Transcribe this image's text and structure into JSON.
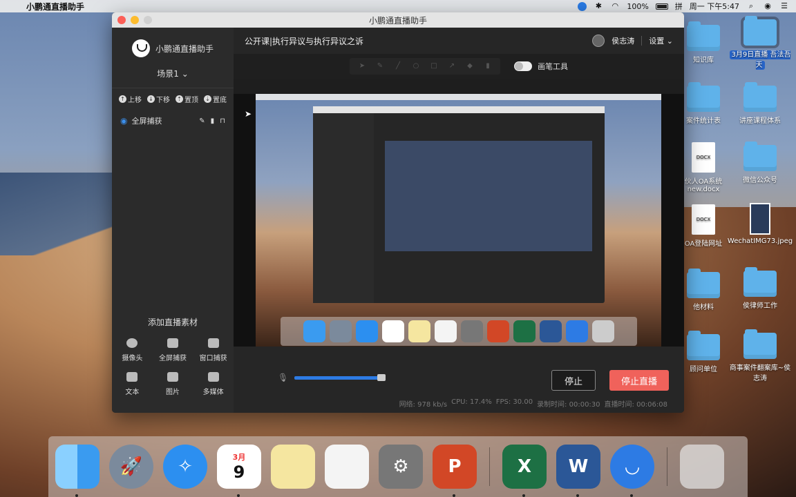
{
  "menubar": {
    "app_name": "小鹏通直播助手",
    "battery": "100%",
    "input_method": "拼",
    "datetime": "周一 下午5:47"
  },
  "desktop": {
    "icons": [
      {
        "label": "知识库",
        "kind": "folder"
      },
      {
        "label": "3月9日直播 吾法吾天",
        "kind": "folder",
        "selected": true
      },
      {
        "label": "案件统计表",
        "kind": "folder"
      },
      {
        "label": "讲座课程体系",
        "kind": "folder"
      },
      {
        "label": "伙人OA系统 new.docx",
        "kind": "doc"
      },
      {
        "label": "微信公众号",
        "kind": "folder"
      },
      {
        "label": "OA登陆网址",
        "kind": "doc"
      },
      {
        "label": "WechatIMG73.jpeg",
        "kind": "image"
      },
      {
        "label": "他材料",
        "kind": "folder"
      },
      {
        "label": "侯律师工作",
        "kind": "folder"
      },
      {
        "label": "顾问单位",
        "kind": "folder"
      },
      {
        "label": "商事案件翻案库~侯志涛",
        "kind": "folder"
      }
    ],
    "doc_badge": "DOCX"
  },
  "window": {
    "title": "小鹏通直播助手",
    "sidebar": {
      "brand": "小鹏通直播助手",
      "scene": "场景1",
      "order_buttons": {
        "up": "上移",
        "down": "下移",
        "top": "置顶",
        "bottom": "置底"
      },
      "sources": [
        {
          "label": "全屏捕获",
          "visible": true
        }
      ],
      "add_title": "添加直播素材",
      "add_items": [
        "摄像头",
        "全屏捕获",
        "窗口捕获",
        "文本",
        "图片",
        "多媒体"
      ]
    },
    "header": {
      "course_title": "公开课|执行异议与执行异议之诉",
      "user_name": "侯志涛",
      "settings": "设置"
    },
    "pen_tool_label": "画笔工具",
    "controls": {
      "volume": 0.9,
      "stop": "停止",
      "stop_live": "停止直播",
      "stats": {
        "network": "网络: 978 kb/s",
        "cpu": "CPU: 17.4%",
        "fps": "FPS: 30.00",
        "record_time": "录制时间: 00:00:30",
        "live_time": "直播时间: 00:06:08"
      }
    }
  },
  "dock": {
    "apps": [
      "Finder",
      "Launchpad",
      "Safari",
      "Calendar",
      "Notes",
      "Reminders",
      "System Preferences",
      "PowerPoint",
      "Excel",
      "Word",
      "小鹏通直播助手",
      "Trash"
    ],
    "calendar_month": "3月",
    "calendar_day": "9"
  },
  "colors": {
    "accent_blue": "#2d7be4",
    "stop_live_red": "#f0625b",
    "folder_blue": "#5fb2ea"
  }
}
